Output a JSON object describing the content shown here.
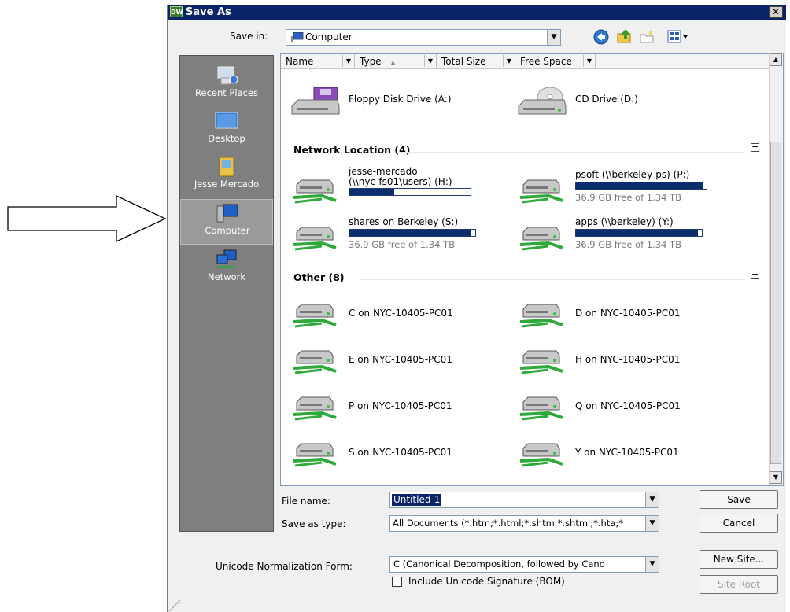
{
  "window": {
    "title": "Save As",
    "app_icon": "DW",
    "close_glyph": "✕"
  },
  "save_in": {
    "label": "Save in:",
    "value": "Computer"
  },
  "toolbar": {
    "icons": [
      "back-icon",
      "up-folder-icon",
      "new-folder-icon",
      "views-menu-icon"
    ]
  },
  "places": [
    {
      "label": "Recent Places",
      "icon": "recent-places-icon"
    },
    {
      "label": "Desktop",
      "icon": "desktop-icon"
    },
    {
      "label": "Jesse Mercado",
      "icon": "user-folder-icon"
    },
    {
      "label": "Computer",
      "icon": "computer-icon",
      "selected": true
    },
    {
      "label": "Network",
      "icon": "network-icon"
    }
  ],
  "columns": [
    {
      "label": "Name"
    },
    {
      "label": "Type",
      "sort_glyph": "▲"
    },
    {
      "label": "Total Size"
    },
    {
      "label": "Free Space"
    }
  ],
  "devices": [
    {
      "name": "Floppy Disk Drive (A:)",
      "icon": "floppy-drive-icon"
    },
    {
      "name": "CD Drive (D:)",
      "icon": "cd-drive-icon"
    }
  ],
  "network_group": {
    "title": "Network Location (4)",
    "items": [
      {
        "name1": "jesse-mercado",
        "name2": "(\\\\nyc-fs01\\users) (H:)",
        "used_fraction": 0.37,
        "free_text": ""
      },
      {
        "name1": "psoft (\\\\berkeley-ps) (P:)",
        "used_fraction": 0.97,
        "free_text": "36.9 GB free of 1.34 TB"
      },
      {
        "name1": "shares on Berkeley (S:)",
        "used_fraction": 0.97,
        "free_text": "36.9 GB free of 1.34 TB"
      },
      {
        "name1": "apps (\\\\berkeley) (Y:)",
        "used_fraction": 0.97,
        "free_text": "36.9 GB free of 1.34 TB"
      }
    ]
  },
  "other_group": {
    "title": "Other (8)",
    "items": [
      "C on NYC-10405-PC01",
      "D on NYC-10405-PC01",
      "E on NYC-10405-PC01",
      "H on NYC-10405-PC01",
      "P on NYC-10405-PC01",
      "Q on NYC-10405-PC01",
      "S on NYC-10405-PC01",
      "Y on NYC-10405-PC01"
    ]
  },
  "collapse_glyph": "−",
  "form": {
    "file_name_label": "File name:",
    "file_name_value": "Untitled-1",
    "save_type_label": "Save as type:",
    "save_type_value": "All Documents (*.htm;*.html;*.shtm;*.shtml;*.hta;*",
    "unicode_label": "Unicode Normalization Form:",
    "unicode_value": "C (Canonical Decomposition, followed by Cano",
    "bom_label": "Include Unicode Signature (BOM)",
    "bom_checked": false
  },
  "buttons": {
    "save": "Save",
    "cancel": "Cancel",
    "new_site": "New Site...",
    "site_root": "Site Root"
  },
  "dropdown_glyph": "▼",
  "colors": {
    "titlebar": "#0a246a",
    "places_bg": "#7f7f7f",
    "bar_fill": "#0c2d6b"
  }
}
